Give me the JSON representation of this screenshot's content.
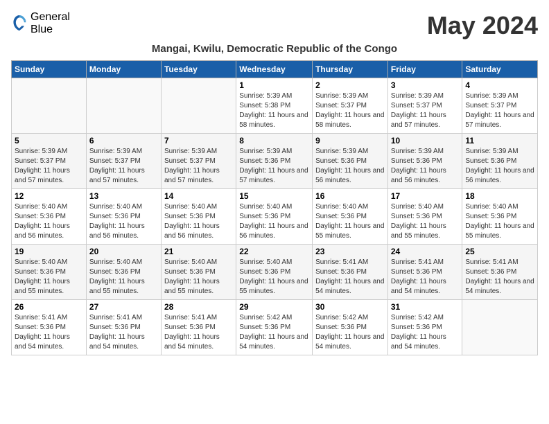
{
  "logo": {
    "general": "General",
    "blue": "Blue"
  },
  "title": "May 2024",
  "location": "Mangai, Kwilu, Democratic Republic of the Congo",
  "days_of_week": [
    "Sunday",
    "Monday",
    "Tuesday",
    "Wednesday",
    "Thursday",
    "Friday",
    "Saturday"
  ],
  "weeks": [
    [
      {
        "day": "",
        "info": ""
      },
      {
        "day": "",
        "info": ""
      },
      {
        "day": "",
        "info": ""
      },
      {
        "day": "1",
        "info": "Sunrise: 5:39 AM\nSunset: 5:38 PM\nDaylight: 11 hours and 58 minutes."
      },
      {
        "day": "2",
        "info": "Sunrise: 5:39 AM\nSunset: 5:37 PM\nDaylight: 11 hours and 58 minutes."
      },
      {
        "day": "3",
        "info": "Sunrise: 5:39 AM\nSunset: 5:37 PM\nDaylight: 11 hours and 57 minutes."
      },
      {
        "day": "4",
        "info": "Sunrise: 5:39 AM\nSunset: 5:37 PM\nDaylight: 11 hours and 57 minutes."
      }
    ],
    [
      {
        "day": "5",
        "info": "Sunrise: 5:39 AM\nSunset: 5:37 PM\nDaylight: 11 hours and 57 minutes."
      },
      {
        "day": "6",
        "info": "Sunrise: 5:39 AM\nSunset: 5:37 PM\nDaylight: 11 hours and 57 minutes."
      },
      {
        "day": "7",
        "info": "Sunrise: 5:39 AM\nSunset: 5:37 PM\nDaylight: 11 hours and 57 minutes."
      },
      {
        "day": "8",
        "info": "Sunrise: 5:39 AM\nSunset: 5:36 PM\nDaylight: 11 hours and 57 minutes."
      },
      {
        "day": "9",
        "info": "Sunrise: 5:39 AM\nSunset: 5:36 PM\nDaylight: 11 hours and 56 minutes."
      },
      {
        "day": "10",
        "info": "Sunrise: 5:39 AM\nSunset: 5:36 PM\nDaylight: 11 hours and 56 minutes."
      },
      {
        "day": "11",
        "info": "Sunrise: 5:39 AM\nSunset: 5:36 PM\nDaylight: 11 hours and 56 minutes."
      }
    ],
    [
      {
        "day": "12",
        "info": "Sunrise: 5:40 AM\nSunset: 5:36 PM\nDaylight: 11 hours and 56 minutes."
      },
      {
        "day": "13",
        "info": "Sunrise: 5:40 AM\nSunset: 5:36 PM\nDaylight: 11 hours and 56 minutes."
      },
      {
        "day": "14",
        "info": "Sunrise: 5:40 AM\nSunset: 5:36 PM\nDaylight: 11 hours and 56 minutes."
      },
      {
        "day": "15",
        "info": "Sunrise: 5:40 AM\nSunset: 5:36 PM\nDaylight: 11 hours and 56 minutes."
      },
      {
        "day": "16",
        "info": "Sunrise: 5:40 AM\nSunset: 5:36 PM\nDaylight: 11 hours and 55 minutes."
      },
      {
        "day": "17",
        "info": "Sunrise: 5:40 AM\nSunset: 5:36 PM\nDaylight: 11 hours and 55 minutes."
      },
      {
        "day": "18",
        "info": "Sunrise: 5:40 AM\nSunset: 5:36 PM\nDaylight: 11 hours and 55 minutes."
      }
    ],
    [
      {
        "day": "19",
        "info": "Sunrise: 5:40 AM\nSunset: 5:36 PM\nDaylight: 11 hours and 55 minutes."
      },
      {
        "day": "20",
        "info": "Sunrise: 5:40 AM\nSunset: 5:36 PM\nDaylight: 11 hours and 55 minutes."
      },
      {
        "day": "21",
        "info": "Sunrise: 5:40 AM\nSunset: 5:36 PM\nDaylight: 11 hours and 55 minutes."
      },
      {
        "day": "22",
        "info": "Sunrise: 5:40 AM\nSunset: 5:36 PM\nDaylight: 11 hours and 55 minutes."
      },
      {
        "day": "23",
        "info": "Sunrise: 5:41 AM\nSunset: 5:36 PM\nDaylight: 11 hours and 54 minutes."
      },
      {
        "day": "24",
        "info": "Sunrise: 5:41 AM\nSunset: 5:36 PM\nDaylight: 11 hours and 54 minutes."
      },
      {
        "day": "25",
        "info": "Sunrise: 5:41 AM\nSunset: 5:36 PM\nDaylight: 11 hours and 54 minutes."
      }
    ],
    [
      {
        "day": "26",
        "info": "Sunrise: 5:41 AM\nSunset: 5:36 PM\nDaylight: 11 hours and 54 minutes."
      },
      {
        "day": "27",
        "info": "Sunrise: 5:41 AM\nSunset: 5:36 PM\nDaylight: 11 hours and 54 minutes."
      },
      {
        "day": "28",
        "info": "Sunrise: 5:41 AM\nSunset: 5:36 PM\nDaylight: 11 hours and 54 minutes."
      },
      {
        "day": "29",
        "info": "Sunrise: 5:42 AM\nSunset: 5:36 PM\nDaylight: 11 hours and 54 minutes."
      },
      {
        "day": "30",
        "info": "Sunrise: 5:42 AM\nSunset: 5:36 PM\nDaylight: 11 hours and 54 minutes."
      },
      {
        "day": "31",
        "info": "Sunrise: 5:42 AM\nSunset: 5:36 PM\nDaylight: 11 hours and 54 minutes."
      },
      {
        "day": "",
        "info": ""
      }
    ]
  ]
}
